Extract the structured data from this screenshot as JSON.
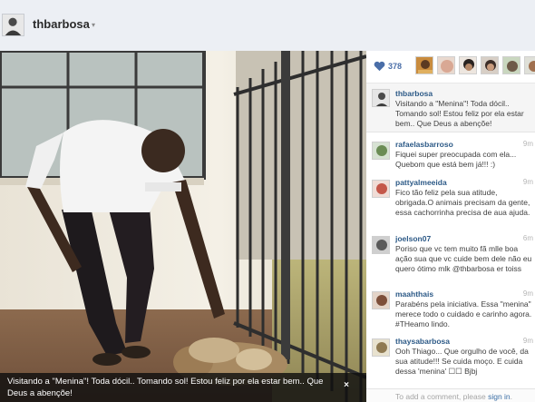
{
  "header": {
    "username": "thbarbosa",
    "caret": "▾"
  },
  "photo": {
    "caption": "Visitando a \"Menina\"! Toda dócil.. Tomando sol! Estou feliz por ela estar bem.. Que Deus a abençõe!",
    "close": "×"
  },
  "likes": {
    "count": "378",
    "heart_color": "#4a6ea8",
    "avatars": [
      "liker-1",
      "liker-2",
      "liker-3",
      "liker-4",
      "liker-5",
      "liker-6"
    ]
  },
  "post": {
    "author": "thbarbosa",
    "text": "Visitando a \"Menina\"! Toda dócil.. Tomando sol! Estou feliz por ela estar bem.. Que Deus a abençõe!"
  },
  "comments": [
    {
      "author": "rafaelasbarroso",
      "time": "9m",
      "text": "Fiquei super preocupada com ela... Quebom que está bem já!!! :)"
    },
    {
      "author": "pattyalmeeida",
      "time": "9m",
      "text": "Fico tão feliz pela sua atitude, obrigada.O animais precisam da gente, essa cachorrinha precisa de aua ajuda."
    },
    {
      "author": "joelson07",
      "time": "6m",
      "text": "Poriso que vc tem muito fã mlle boa ação sua que vc cuide bem dele não eu quero ótimo mlk @thbarbosa er toiss"
    },
    {
      "author": "maahthais",
      "time": "9m",
      "text": "Parabéns pela iniciativa. Essa \"menina\" merece todo o cuidado e carinho agora. #THeamo lindo."
    },
    {
      "author": "thaysabarbosa",
      "time": "9m",
      "text": "Ooh Thiago... Que orgulho de você, da sua atitude!!! Se cuida moço. E cuida dessa 'menina' ☐☐ Bjbj"
    }
  ],
  "comment_box": {
    "prefix": "To add a comment, please",
    "link": "sign in",
    "suffix": "."
  }
}
